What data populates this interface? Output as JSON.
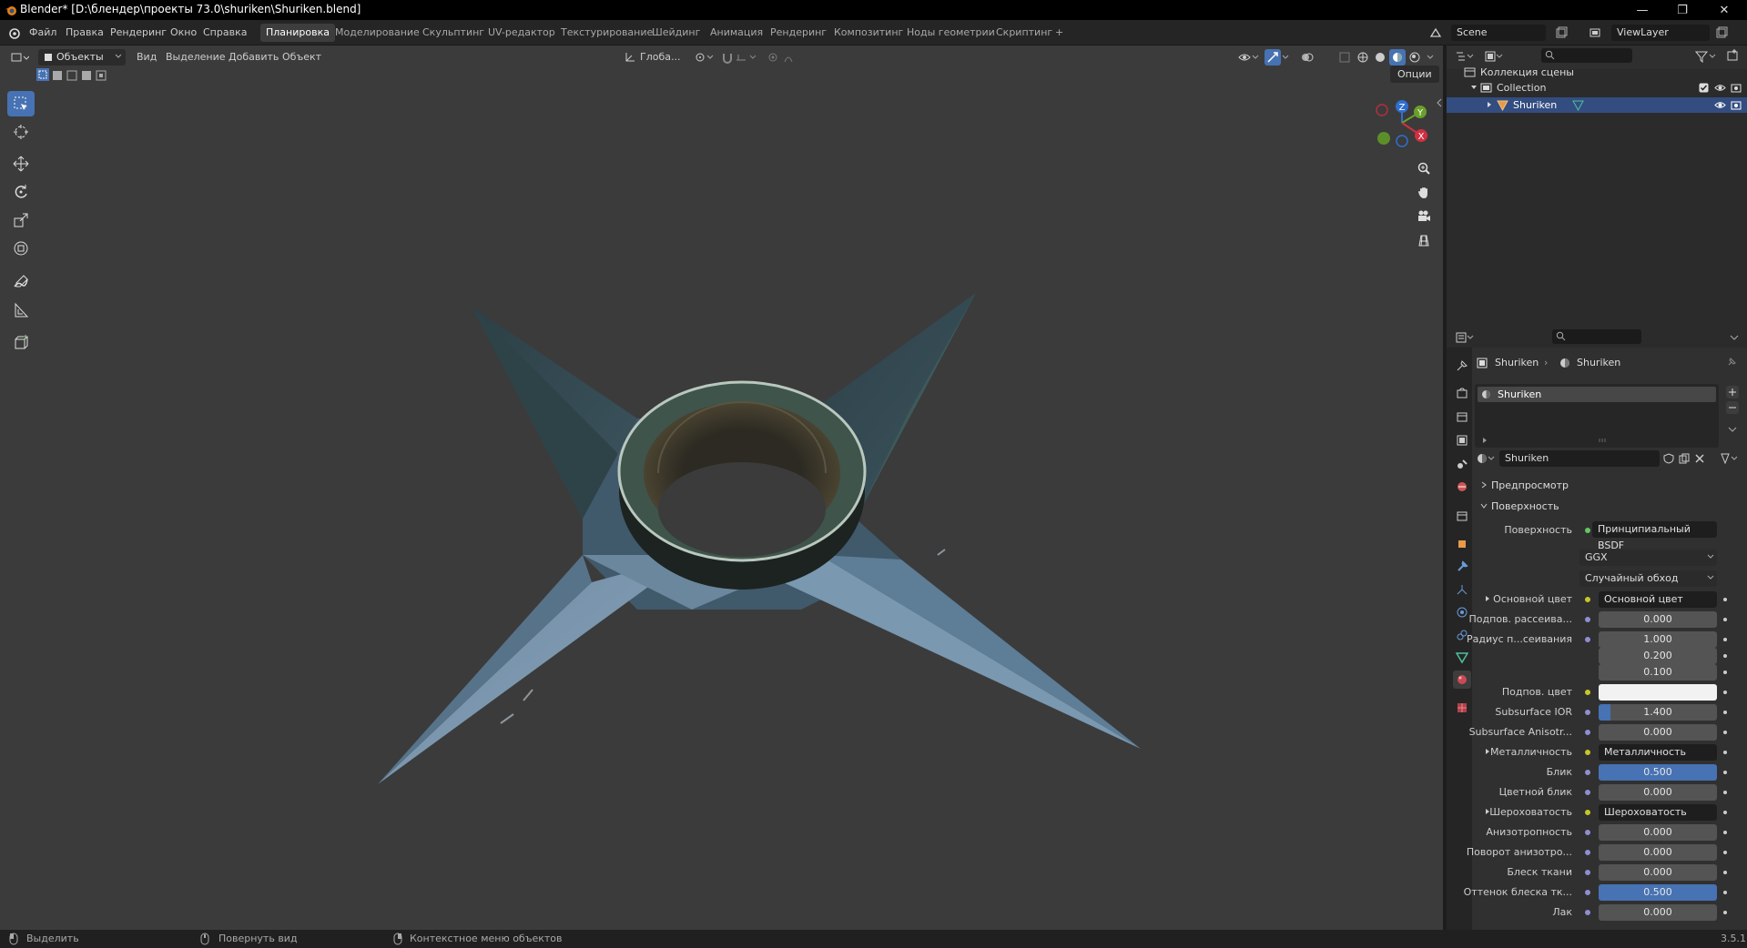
{
  "window": {
    "title": "Blender* [D:\\блендер\\проекты 73.0\\shuriken\\Shuriken.blend]",
    "minimize": "—",
    "maximize": "❐",
    "close": "✕"
  },
  "topbar": {
    "menus": [
      "Файл",
      "Правка",
      "Рендеринг",
      "Окно",
      "Справка"
    ],
    "workspaces": [
      "Планировка",
      "Моделирование",
      "Скульптинг",
      "UV-редактор",
      "Текстурирование",
      "Шейдинг",
      "Анимация",
      "Рендеринг",
      "Композитинг",
      "Ноды геометрии",
      "Скриптинг",
      "+"
    ],
    "active_workspace": "Планировка",
    "scene": "Scene",
    "view_layer": "ViewLayer"
  },
  "viewport_header": {
    "mode": "Объекты",
    "menus": [
      "Вид",
      "Выделение",
      "Добавить",
      "Объект"
    ],
    "transform_orientation": "Глоба...",
    "options": "Опции"
  },
  "outliner": {
    "scene_collection": "Коллекция сцены",
    "collection": "Collection",
    "object": "Shuriken"
  },
  "properties": {
    "breadcrumb_object": "Shuriken",
    "breadcrumb_material": "Shuriken",
    "slot_name": "Shuriken",
    "material_name": "Shuriken",
    "preview_panel": "Предпросмотр",
    "surface_panel": "Поверхность",
    "surface_label": "Поверхность",
    "surface_shader": "Принципиальный BSDF",
    "distribution": "GGX",
    "subsurface_method": "Случайный обход",
    "rows": [
      {
        "label": "Основной цвет",
        "kind": "link",
        "value": "Основной цвет",
        "expand": true
      },
      {
        "label": "Подпов. рассеива...",
        "kind": "num",
        "value": "0.000"
      },
      {
        "label": "Радиус п...сеивания",
        "kind": "num",
        "value": "1.000"
      },
      {
        "label": "",
        "kind": "num",
        "value": "0.200"
      },
      {
        "label": "",
        "kind": "num",
        "value": "0.100"
      },
      {
        "label": "Подпов. цвет",
        "kind": "color",
        "value": ""
      },
      {
        "label": "Subsurface IOR",
        "kind": "bar",
        "value": "1.400",
        "fill": 0.1
      },
      {
        "label": "Subsurface Anisotr...",
        "kind": "num",
        "value": "0.000"
      },
      {
        "label": "Металличность",
        "kind": "link",
        "value": "Металличность",
        "expand": true
      },
      {
        "label": "Блик",
        "kind": "bar",
        "value": "0.500",
        "fill": 1.0
      },
      {
        "label": "Цветной блик",
        "kind": "num",
        "value": "0.000"
      },
      {
        "label": "Шероховатость",
        "kind": "link",
        "value": "Шероховатость",
        "expand": true
      },
      {
        "label": "Анизотропность",
        "kind": "num",
        "value": "0.000"
      },
      {
        "label": "Поворот анизотро...",
        "kind": "num",
        "value": "0.000"
      },
      {
        "label": "Блеск ткани",
        "kind": "num",
        "value": "0.000"
      },
      {
        "label": "Оттенок блеска тк...",
        "kind": "bar",
        "value": "0.500",
        "fill": 1.0
      },
      {
        "label": "Лак",
        "kind": "num",
        "value": "0.000"
      }
    ]
  },
  "statusbar": {
    "select": "Выделить",
    "rotate": "Повернуть вид",
    "context": "Контекстное меню объектов",
    "version": "3.5.1"
  },
  "gizmo": {
    "x": "X",
    "y": "Y",
    "z": "Z"
  },
  "colors": {
    "accent": "#4772b3",
    "selected_row": "#334d80",
    "viewport_bg": "#3b3b3b"
  }
}
